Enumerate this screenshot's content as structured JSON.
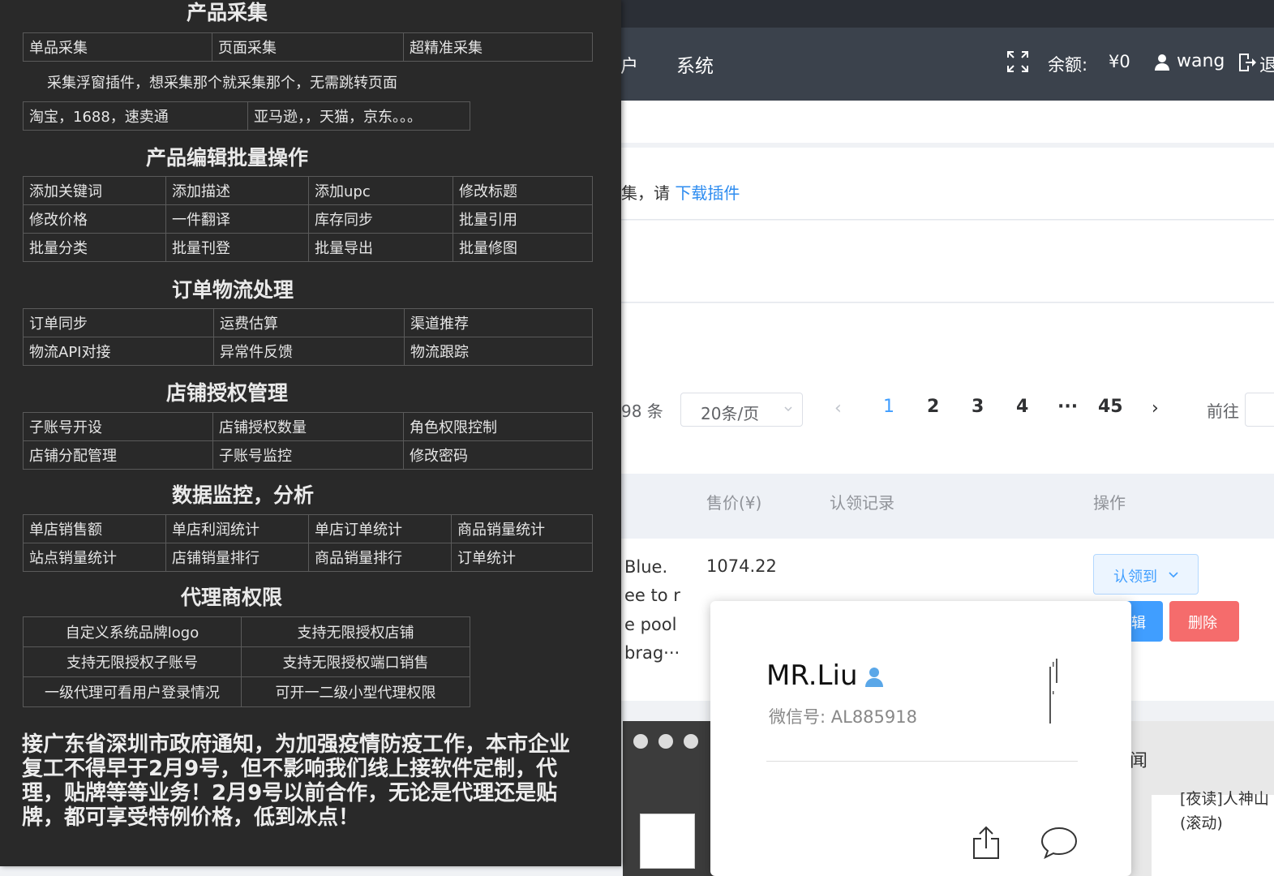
{
  "navbar": {
    "left_fragment": "户",
    "system_label": "系统",
    "balance_label": "余额:",
    "balance_value": "¥0",
    "username": "wang",
    "logout_fragment": "退"
  },
  "notice": {
    "text": "集，请 ",
    "link": "下载插件"
  },
  "pagination": {
    "total_fragment": "98 条",
    "page_size": "20条/页",
    "pages": [
      "1",
      "2",
      "3",
      "4",
      "···",
      "45"
    ],
    "active_page": "1",
    "goto_label": "前往"
  },
  "table": {
    "headers": [
      "售价(¥)",
      "认领记录",
      "操作"
    ],
    "row": {
      "desc_lines": [
        "Blue.",
        "ee to r",
        "e pool",
        "brag···"
      ],
      "price": "1074.22",
      "claim_label": "认领到",
      "edit_label": "辑",
      "delete_label": "删除"
    }
  },
  "mac_window": {
    "fragment_1": "闻",
    "fragment_2": "[夜读]人神山",
    "fragment_3": "(滚动)"
  },
  "contact_card": {
    "name": "MR.Liu",
    "wechat": "微信号: AL885918"
  },
  "panel": {
    "sections": [
      {
        "title": "产品采集",
        "rows": [
          [
            "单品采集",
            "页面采集",
            "超精准采集"
          ]
        ],
        "intro": "采集浮窗插件，想采集那个就采集那个，无需跳转页面",
        "sub_rows": [
          [
            "淘宝，1688，速卖通",
            "亚马逊，，天猫，京东。。。"
          ]
        ]
      },
      {
        "title": "产品编辑批量操作",
        "rows": [
          [
            "添加关键词",
            "添加描述",
            "添加upc",
            "修改标题"
          ],
          [
            "修改价格",
            "一件翻译",
            "库存同步",
            "批量引用"
          ],
          [
            "批量分类",
            "批量刊登",
            "批量导出",
            "批量修图"
          ]
        ]
      },
      {
        "title": "订单物流处理",
        "rows": [
          [
            "订单同步",
            "运费估算",
            "渠道推荐"
          ],
          [
            "物流API对接",
            "异常件反馈",
            "物流跟踪"
          ]
        ]
      },
      {
        "title": "店铺授权管理",
        "rows": [
          [
            "子账号开设",
            "店铺授权数量",
            "角色权限控制"
          ],
          [
            "店铺分配管理",
            "子账号监控",
            "修改密码"
          ]
        ]
      },
      {
        "title": "数据监控，分析",
        "rows": [
          [
            "单店销售额",
            "单店利润统计",
            "单店订单统计",
            "商品销量统计"
          ],
          [
            "站点销量统计",
            "店铺销量排行",
            "商品销量排行",
            "订单统计"
          ]
        ]
      },
      {
        "title": "代理商权限",
        "rows": [
          [
            "自定义系统品牌logo",
            "支持无限授权店铺"
          ],
          [
            "支持无限授权子账号",
            "支持无限授权端口销售"
          ],
          [
            "一级代理可看用户登录情况",
            "可开一二级小型代理权限"
          ]
        ]
      }
    ],
    "notice": "接广东省深圳市政府通知，为加强疫情防疫工作，本市企业复工不得早于2月9号，但不影响我们线上接软件定制，代理，贴牌等等业务！2月9号以前合作，无论是代理还是贴牌，都可享受特例价格，低到冰点！"
  }
}
